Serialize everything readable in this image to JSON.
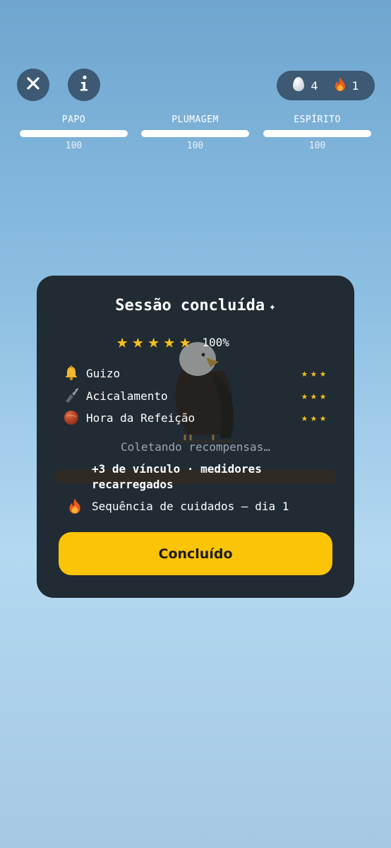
{
  "header": {
    "close_icon": "close-icon",
    "info_icon": "info-icon",
    "eggs_count": "4",
    "streak_count": "1"
  },
  "meters": [
    {
      "label": "PAPO",
      "value": "100",
      "level_percent": 100
    },
    {
      "label": "PLUMAGEM",
      "value": "100",
      "level_percent": 100
    },
    {
      "label": "ESPÍRITO",
      "value": "100",
      "level_percent": 100
    }
  ],
  "modal": {
    "title": "Sessão concluída",
    "title_icon": "sparkle-icon",
    "rating_stars": 5,
    "score": "100%",
    "tasks": [
      {
        "label": "Guizo",
        "icon": "bell-icon",
        "stars": 3
      },
      {
        "label": "Acicalamento",
        "icon": "grooming-brush-icon",
        "stars": 3
      },
      {
        "label": "Hora da Refeição",
        "icon": "food-ball-icon",
        "stars": 3
      }
    ],
    "collecting_text": "Coletando recompensas…",
    "bond_text": "+3 de vínculo · medidores recarregados",
    "streak_text": "Sequência de cuidados — dia 1",
    "done_label": "Concluído"
  },
  "colors": {
    "accent": "#fcc407",
    "card_bg": "#212b33",
    "star": "#f6c21a",
    "header_button": "#3d5973"
  }
}
